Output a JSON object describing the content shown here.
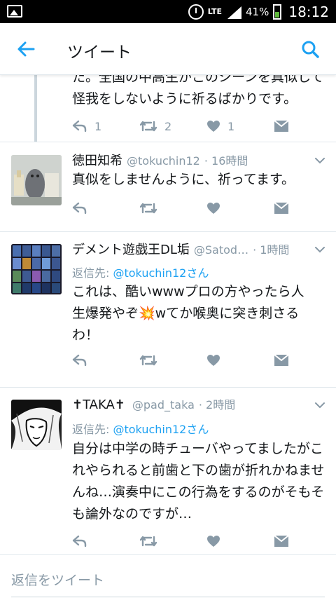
{
  "status_bar": {
    "network": "LTE",
    "battery": "41%",
    "time": "18:12",
    "icons": [
      "image-icon",
      "alarm-icon",
      "signal-icon",
      "battery-icon"
    ]
  },
  "header": {
    "title": "ツイート",
    "back_icon": "arrow-left-icon",
    "search_icon": "search-icon"
  },
  "parent_tweet": {
    "text": "た。全国の中高生がこのシーンを真似して怪我をしないように祈るばかりです。",
    "reply_count": "1",
    "retweet_count": "2",
    "like_count": "1"
  },
  "tweets": [
    {
      "name": "徳田知希",
      "handle": "@tokuchin12",
      "time": "· 16時間",
      "reply_to_label": "",
      "reply_to_handle": "",
      "text": "真似をしませんように、祈ってます。"
    },
    {
      "name": "デメント遊戯王DL垢",
      "handle": "@Satod…",
      "time": "· 1時間",
      "reply_to_label": "返信先: ",
      "reply_to_handle": "@tokuchin12さん",
      "text": "これは、酷いwwwプロの方やったら人生爆発やぞ💥wてか喉奥に突き刺さるわ！"
    },
    {
      "name": "✝TAKA✝",
      "handle": "@pad_taka",
      "time": "· 2時間",
      "reply_to_label": "返信先: ",
      "reply_to_handle": "@tokuchin12さん",
      "text": "自分は中学の時チューバやってましたがこれやられると前歯と下の歯が折れかねませんね…演奏中にこの行為をするのがそもそも論外なのですが…"
    }
  ],
  "compose": {
    "placeholder": "返信をツイート"
  },
  "colors": {
    "accent": "#1da1f2",
    "icon_gray": "#8899a6",
    "divider": "#e1e8ed",
    "text": "#14171a"
  }
}
